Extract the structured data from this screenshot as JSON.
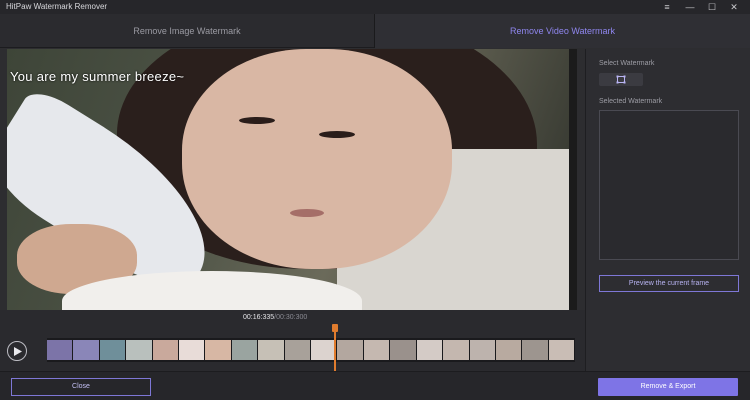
{
  "app": {
    "title": "HitPaw Watermark Remover",
    "window_controls": [
      "≡",
      "—",
      "☐",
      "✕"
    ]
  },
  "tabs": [
    {
      "label": "Remove Image Watermark",
      "active": false
    },
    {
      "label": "Remove Video Watermark",
      "active": true
    }
  ],
  "video": {
    "overlay_text": "You are my summer breeze~"
  },
  "right_panel": {
    "select_watermark_label": "Select Watermark",
    "selected_watermark_label": "Selected Watermark",
    "preview_button": "Preview the current frame"
  },
  "timeline": {
    "current_time": "00:16:335",
    "total_time": "/00:30:300",
    "frame_colors": [
      "#7c74a8",
      "#8a86b8",
      "#6f8f9a",
      "#b9c0bd",
      "#c9a99c",
      "#e8dcd8",
      "#d7b7a4",
      "#9aa4a0",
      "#c6c0b6",
      "#a8a19a",
      "#dcd3cf",
      "#b3a79f",
      "#c5b8b0",
      "#9a918c",
      "#d4cbc6",
      "#c4b7af",
      "#bdb3ad",
      "#b8aaa0",
      "#9d958f",
      "#c9bdb5"
    ]
  },
  "footer": {
    "close_button": "Close",
    "export_button": "Remove & Export"
  },
  "colors": {
    "accent": "#7e74e6",
    "playhead": "#e07c2e"
  }
}
